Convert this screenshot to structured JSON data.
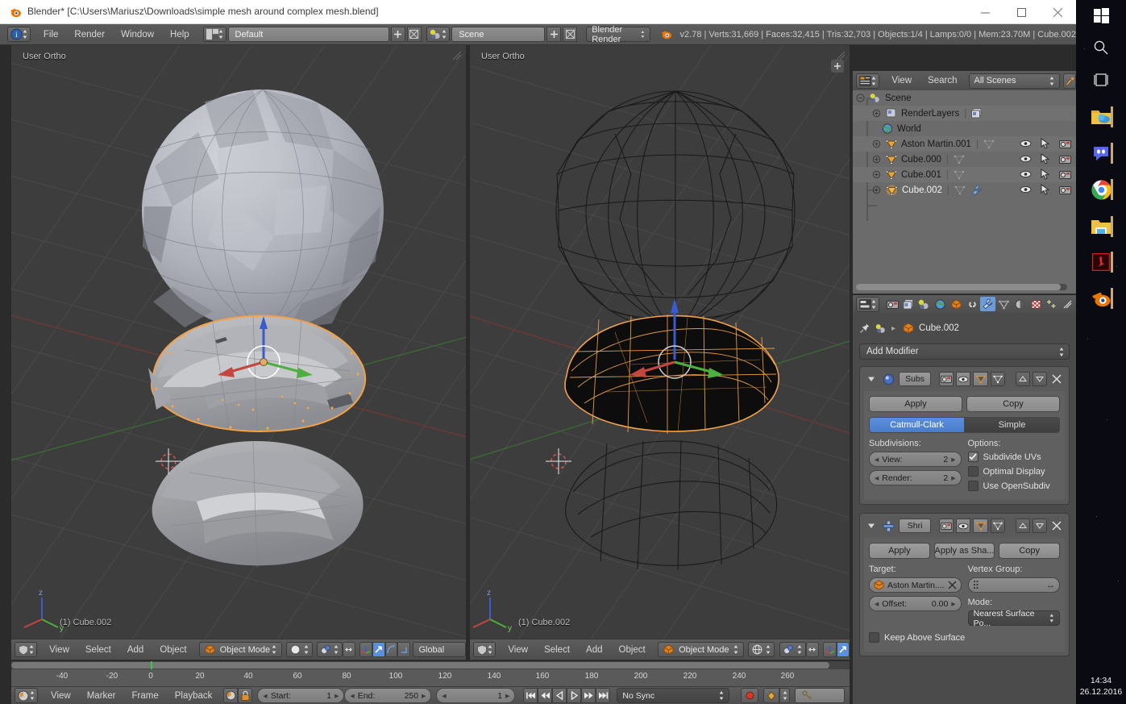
{
  "window": {
    "title": "Blender* [C:\\Users\\Mariusz\\Downloads\\simple mesh around complex mesh.blend]",
    "minimize": "—",
    "maximize": "☐",
    "close": "✕"
  },
  "topbar": {
    "menus": [
      "File",
      "Render",
      "Window",
      "Help"
    ],
    "screen_layout": "Default",
    "scene": "Scene",
    "engine": "Blender Render",
    "add_label": "+",
    "remove_label": "✕",
    "stats": "v2.78 | Verts:31,669 | Faces:32,415 | Tris:32,703 | Objects:1/4 | Lamps:0/0 | Mem:23.70M | Cube.002"
  },
  "viewports": [
    {
      "name": "left",
      "view_label": "User Ortho",
      "active_object": "(1) Cube.002",
      "header": {
        "menus": [
          "View",
          "Select",
          "Add",
          "Object"
        ],
        "mode": "Object Mode",
        "orientation": "Global"
      }
    },
    {
      "name": "right",
      "view_label": "User Ortho",
      "active_object": "(1) Cube.002",
      "header": {
        "menus": [
          "View",
          "Select",
          "Add",
          "Object"
        ],
        "mode": "Object Mode",
        "orientation": ""
      }
    }
  ],
  "outliner": {
    "header": {
      "menus": [
        "View",
        "Search"
      ],
      "display_mode": "All Scenes"
    },
    "rows": [
      {
        "label": "Scene",
        "indent": 0,
        "icon": "scene-icon",
        "selected": false,
        "expander": "minus",
        "extra": []
      },
      {
        "label": "RenderLayers",
        "indent": 1,
        "icon": "renderlayers-icon",
        "selected": false,
        "expander": "plus",
        "extra": [
          "renderlayer-data-icon"
        ]
      },
      {
        "label": "World",
        "indent": 1,
        "icon": "world-icon",
        "selected": false,
        "expander": "none",
        "extra": []
      },
      {
        "label": "Aston Martin.001",
        "indent": 1,
        "icon": "mesh-object-icon",
        "selected": false,
        "expander": "plus",
        "extra": [
          "mesh-data-icon"
        ]
      },
      {
        "label": "Cube.000",
        "indent": 1,
        "icon": "mesh-object-icon",
        "selected": false,
        "expander": "plus",
        "extra": [
          "mesh-data-icon"
        ]
      },
      {
        "label": "Cube.001",
        "indent": 1,
        "icon": "mesh-object-icon",
        "selected": false,
        "expander": "plus",
        "extra": [
          "mesh-data-icon"
        ]
      },
      {
        "label": "Cube.002",
        "indent": 1,
        "icon": "mesh-object-icon",
        "selected": true,
        "expander": "plus",
        "extra": [
          "mesh-data-icon",
          "wrench-icon"
        ]
      }
    ]
  },
  "properties": {
    "active_tab": "modifiers",
    "breadcrumb_object": "Cube.002",
    "add_modifier": "Add Modifier",
    "modifiers": [
      {
        "short_name": "Subs",
        "full_name": "Subsurf",
        "type_icon": "subsurf-icon",
        "buttons": [
          "Apply",
          "Copy"
        ],
        "algorithm_options": [
          "Catmull-Clark",
          "Simple"
        ],
        "algorithm_selected": "Catmull-Clark",
        "subdivisions_label": "Subdivisions:",
        "options_label": "Options:",
        "fields": [
          {
            "label": "View:",
            "value": "2"
          },
          {
            "label": "Render:",
            "value": "2"
          }
        ],
        "checkboxes": [
          {
            "label": "Subdivide UVs",
            "checked": true
          },
          {
            "label": "Optimal Display",
            "checked": false
          },
          {
            "label": "Use OpenSubdiv",
            "checked": false
          }
        ]
      },
      {
        "short_name": "Shri",
        "full_name": "Shrinkwrap",
        "type_icon": "shrinkwrap-icon",
        "buttons": [
          "Apply",
          "Apply as Sha...",
          "Copy"
        ],
        "target_label": "Target:",
        "target_value": "Aston Martin....",
        "vertex_group_label": "Vertex Group:",
        "vertex_group_value": "",
        "offset_label": "Offset:",
        "offset_value": "0.00",
        "mode_label": "Mode:",
        "mode_value": "Nearest Surface Po...",
        "checkboxes": [
          {
            "label": "Keep Above Surface",
            "checked": false
          }
        ]
      }
    ]
  },
  "timeline": {
    "menus": [
      "View",
      "Marker",
      "Frame",
      "Playback"
    ],
    "start_label": "Start:",
    "start_value": "1",
    "end_label": "End:",
    "end_value": "250",
    "current_frame": "1",
    "sync_mode": "No Sync",
    "ticks": [
      "-40",
      "-20",
      "0",
      "20",
      "40",
      "60",
      "80",
      "100",
      "120",
      "140",
      "160",
      "180",
      "200",
      "220",
      "240",
      "260"
    ],
    "transport": [
      "jump-start-icon",
      "prev-keyframe-icon",
      "play-reverse-icon",
      "play-icon",
      "next-keyframe-icon",
      "jump-end-icon"
    ]
  },
  "taskbar": {
    "icons": [
      "windows-start-icon",
      "search-icon",
      "task-view-icon",
      "onedrive-folder-icon",
      "discord-icon",
      "chrome-icon",
      "file-explorer-icon",
      "adobe-reader-icon",
      "blender-icon"
    ],
    "clock_time": "14:34",
    "clock_date": "26.12.2016"
  },
  "colors": {
    "accent_blue": "#5b8fdc",
    "selection_orange": "#f0a14a",
    "axis_x": "#c4473f",
    "axis_y": "#4eaf3f",
    "axis_z": "#3a5ad0",
    "viewport_bg": "#3d3d3d",
    "panel_bg": "#4b4b4b"
  }
}
